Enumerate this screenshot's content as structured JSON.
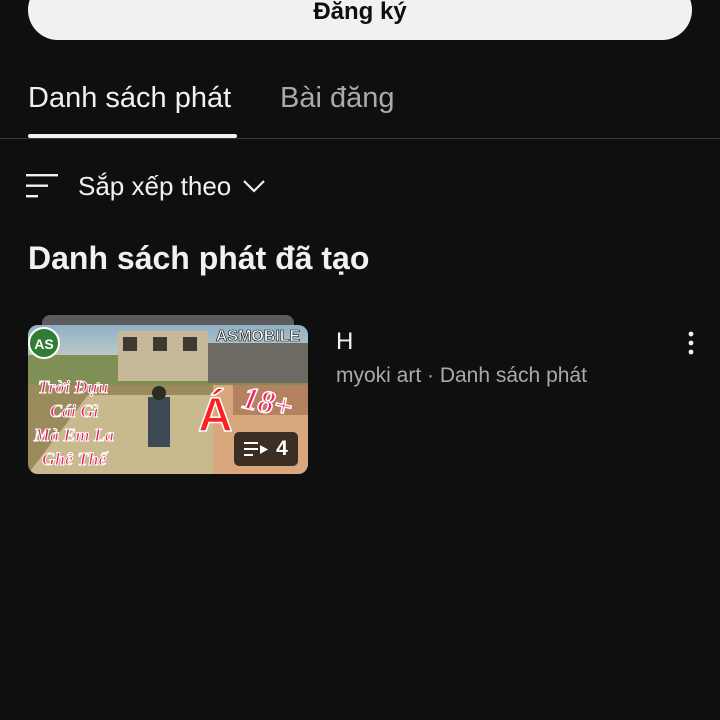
{
  "subscribe": {
    "label": "Đăng ký"
  },
  "tabs": [
    {
      "label": "Danh sách phát",
      "active": true
    },
    {
      "label": "Bài đăng",
      "active": false
    }
  ],
  "sort": {
    "label": "Sắp xếp theo",
    "icon": "sort-icon"
  },
  "section": {
    "title": "Danh sách phát đã tạo"
  },
  "playlist": {
    "title": "H",
    "meta": "myoki art · Danh sách phát",
    "count": "4",
    "thumbnail_text": {
      "caption_lines": [
        "Trời Đựu",
        "Cái Gì",
        "Mà Em La",
        "Ghê Thế"
      ],
      "big_letter": "Á",
      "rating": "18+",
      "logo": "ASMOBILE",
      "badge": "AS"
    }
  },
  "colors": {
    "background": "#0f0f0f",
    "text_primary": "#f1f1f1",
    "text_secondary": "#aaaaaa",
    "button_bg": "#f1f1f1"
  }
}
